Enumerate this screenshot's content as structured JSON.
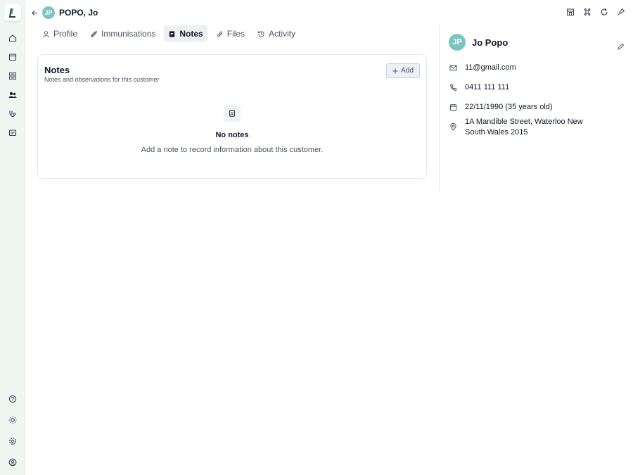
{
  "header": {
    "patient_name": "POPO, Jo",
    "avatar_initials": "JP"
  },
  "tabs": [
    {
      "label": "Profile",
      "icon": "user-icon",
      "active": false
    },
    {
      "label": "Immunisations",
      "icon": "syringe-icon",
      "active": false
    },
    {
      "label": "Notes",
      "icon": "note-icon",
      "active": true
    },
    {
      "label": "Files",
      "icon": "paperclip-icon",
      "active": false
    },
    {
      "label": "Activity",
      "icon": "history-icon",
      "active": false
    }
  ],
  "notes": {
    "title": "Notes",
    "subtitle": "Notes and observations for this customer",
    "add_label": "Add",
    "empty_title": "No notes",
    "empty_desc": "Add a note to record information about this customer."
  },
  "customer": {
    "initials": "JP",
    "name": "Jo Popo",
    "email": "11@gmail.com",
    "phone": "0411 111 111",
    "dob": "22/11/1990 (35 years old)",
    "address": "1A Mandible Street, Waterloo New South Wales 2015"
  },
  "rail": {
    "top_icons": [
      "home-icon",
      "calendar-icon",
      "grid-icon",
      "customers-icon",
      "stethoscope-icon",
      "messages-icon"
    ],
    "bottom_icons": [
      "help-icon",
      "sun-icon",
      "settings-icon",
      "account-icon"
    ]
  },
  "colors": {
    "rail_bg": "#f0f7f3",
    "avatar": "#7cc4bf",
    "active_tab_bg": "#eef0f2",
    "add_button_bg": "#eef0f7"
  }
}
